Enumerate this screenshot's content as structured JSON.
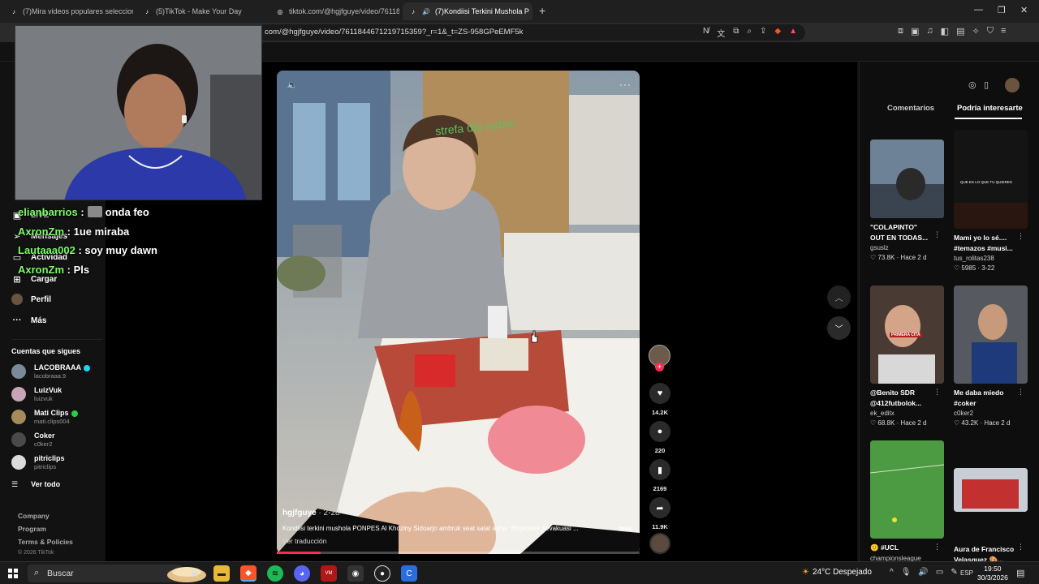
{
  "browser": {
    "tabs": [
      {
        "title": "(7)Mira videos populares seleccionad",
        "active": false
      },
      {
        "title": "(5)TikTok - Make Your Day",
        "active": false
      },
      {
        "title": "tiktok.com/@hgjfguye/video/76118",
        "active": false
      },
      {
        "title": "(7)Kondiisi Terkini Mushola P",
        "active": true
      }
    ],
    "new_tab": "+",
    "url": "com/@hgjfguye/video/7611844671219715359?_r=1&_t=ZS-958GPeEMF5k"
  },
  "chat": [
    {
      "user": "elianbarrios",
      "message": "onda feo",
      "emote": true
    },
    {
      "user": "AxronZm",
      "message": "1ue miraba",
      "emote": false
    },
    {
      "user": "Lautaaa002",
      "message": "soy muy dawn",
      "emote": false
    },
    {
      "user": "AxronZm",
      "message": "Pls",
      "emote": false
    }
  ],
  "nav": {
    "live": "LIVE",
    "messages": "Mensajes",
    "activity": "Actividad",
    "upload": "Cargar",
    "profile": "Perfil",
    "more": "Más"
  },
  "following": {
    "title": "Cuentas que sigues",
    "accounts": [
      {
        "name": "LACOBRAAA",
        "handle": "lacobraaa.9",
        "verified": "blue",
        "avatar_color": "#7a8a9a"
      },
      {
        "name": "LuizVuk",
        "handle": "luizvuk",
        "verified": "",
        "avatar_color": "#c9a4b8"
      },
      {
        "name": "Mati Clips",
        "handle": "mati.clips004",
        "verified": "green",
        "avatar_color": "#a68a5a"
      },
      {
        "name": "Coker",
        "handle": "c0ker2",
        "verified": "",
        "avatar_color": "#4a4a4a"
      },
      {
        "name": "pitriclips",
        "handle": "pitriclips",
        "verified": "",
        "avatar_color": "#dcdcdc"
      }
    ],
    "see_all": "Ver todo"
  },
  "footer": {
    "company": "Company",
    "program": "Program",
    "terms": "Terms & Policies",
    "copyright": "© 2026 TikTok"
  },
  "video": {
    "author": "hgjfguye",
    "date": "· 2-28",
    "description": "Kondiisi terkini mushola PONPES Al Khoziny Sidoarjo ambruk seat salat ashar #jtvjember #evakuasi ...",
    "more": "más",
    "translate": "Ver traducción",
    "progress_pct": 12
  },
  "actions": {
    "likes": "14.2K",
    "comments": "220",
    "saves": "2169",
    "shares": "11.9K"
  },
  "right_panel": {
    "tab_comments": "Comentarios",
    "tab_interest": "Podría interesarte",
    "cards": [
      {
        "title": "\"COLAPINTO\"",
        "title2": "OUT EN TODAS...",
        "user": "gsuslz",
        "meta": "♡ 73.8K · Hace 2 d"
      },
      {
        "title": "Mami yo lo sé....",
        "title2": "#temazos #musi...",
        "user": "tus_rolitas238",
        "meta": "♡ 5985 · 3-22",
        "overlay": "QUE ES LO QUE TU QUIERES"
      },
      {
        "title": "@Benito SDR",
        "title2": "@412futbolok...",
        "user": "ek_editx",
        "meta": "♡ 68.8K · Hace 2 d",
        "overlay": "PRIMERA CITA"
      },
      {
        "title": "Me daba miedo",
        "title2": "#coker",
        "user": "c0ker2",
        "meta": "♡ 43.2K · Hace 2 d"
      },
      {
        "title": "🙂 #UCL",
        "title2": "",
        "user": "championsleague",
        "meta": ""
      },
      {
        "title": "Aura de Francisco",
        "title2": "Velasquez 🎨...",
        "user": "",
        "meta": ""
      }
    ]
  },
  "taskbar": {
    "search": "Buscar",
    "weather": "24°C  Despejado",
    "lang": "ESP",
    "time": "19:50",
    "date": "30/3/2026"
  },
  "colors": {
    "accent": "#fe2c55",
    "chat_user": "#7cff65",
    "verified_blue": "#20d5ec"
  }
}
